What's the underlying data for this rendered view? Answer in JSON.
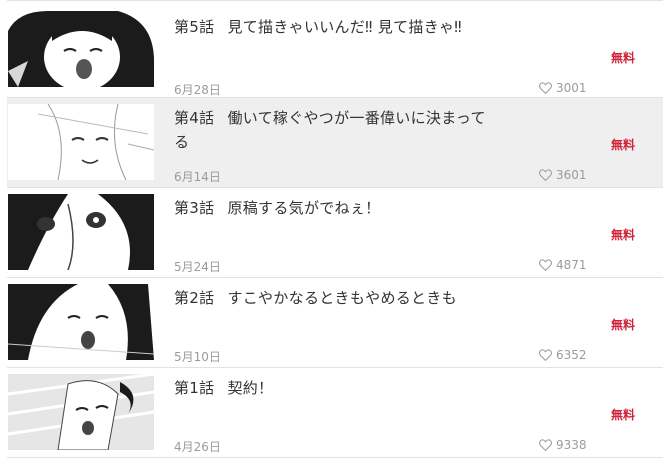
{
  "episodes": [
    {
      "number": "第5話",
      "title": "見て描きゃいいんだ‼ 見て描きゃ‼",
      "date": "6月28日",
      "likes": "3001",
      "badge": "無料"
    },
    {
      "number": "第4話",
      "title": "働いて稼ぐやつが一番偉いに決まってる",
      "date": "6月14日",
      "likes": "3601",
      "badge": "無料"
    },
    {
      "number": "第3話",
      "title": "原稿する気がでねぇ！",
      "date": "5月24日",
      "likes": "4871",
      "badge": "無料"
    },
    {
      "number": "第2話",
      "title": "すこやかなるときもやめるときも",
      "date": "5月10日",
      "likes": "6352",
      "badge": "無料"
    },
    {
      "number": "第1話",
      "title": "契約！",
      "date": "4月26日",
      "likes": "9338",
      "badge": "無料"
    }
  ],
  "colors": {
    "badge": "#d0233a",
    "highlight_row": "#efefef",
    "meta_text": "#9b9b9b"
  },
  "icons": {
    "likes": "heart-outline-icon"
  }
}
